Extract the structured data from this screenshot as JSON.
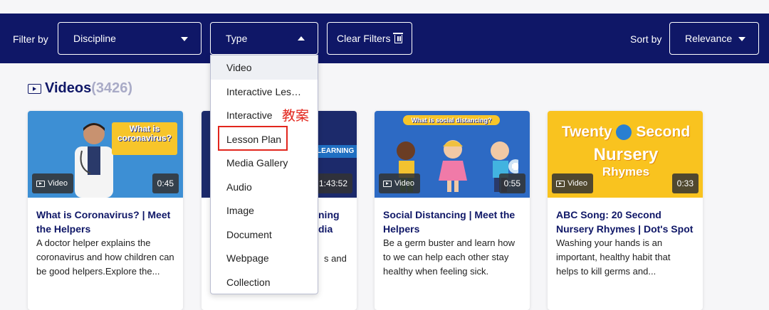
{
  "filterbar": {
    "filter_label": "Filter by",
    "discipline_label": "Discipline",
    "type_label": "Type",
    "clear_label": "Clear Filters",
    "sort_label": "Sort by",
    "relevance_label": "Relevance"
  },
  "section": {
    "name": "Videos",
    "count": "(3426)"
  },
  "type_dropdown": {
    "items": [
      "Video",
      "Interactive Les…",
      "Interactive",
      "Lesson Plan",
      "Media Gallery",
      "Audio",
      "Image",
      "Document",
      "Webpage",
      "Collection"
    ]
  },
  "annotation": {
    "text": "教案"
  },
  "cards": [
    {
      "thumb_text": "What is coronavirus?",
      "badge": "Video",
      "duration": "0:45",
      "title": "What is Coronavirus? | Meet the Helpers",
      "desc": "A doctor helper explains the coronavirus and how children can be good helpers.Explore the..."
    },
    {
      "thumb_text": "LEARNING",
      "badge": "",
      "duration": "1:43:52",
      "title": "ning dia",
      "desc": "s and"
    },
    {
      "thumb_text": "What is social distancing?",
      "badge": "Video",
      "duration": "0:55",
      "title": "Social Distancing | Meet the Helpers",
      "desc": "Be a germ buster and learn how to we can help each other stay healthy when feeling sick."
    },
    {
      "thumb_text_1": "Twenty",
      "thumb_text_1b": "Second",
      "thumb_text_2": "Nursery",
      "thumb_text_3": "Rhymes",
      "badge": "Video",
      "duration": "0:33",
      "title": "ABC Song: 20 Second Nursery Rhymes | Dot's Spot",
      "desc": "Washing your hands is an important, healthy habit that helps to kill germs and..."
    }
  ],
  "colors": {
    "navy": "#0f1767",
    "count_gray": "#a9abc7",
    "annotation_red": "#e2261d"
  }
}
